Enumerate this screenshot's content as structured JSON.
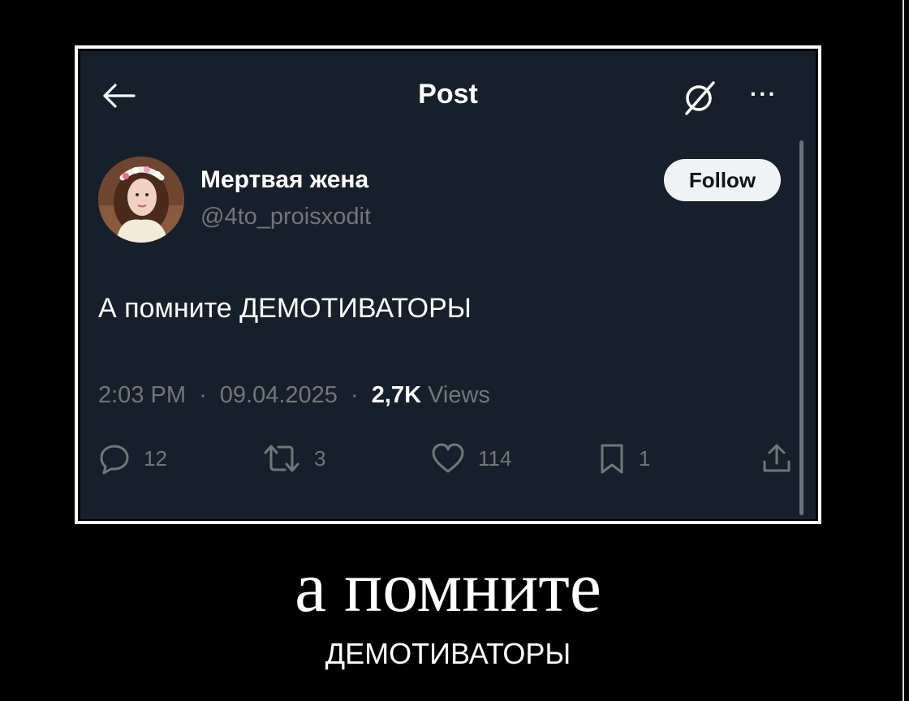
{
  "post": {
    "header": {
      "title": "Post",
      "back_icon": "arrow-left-icon",
      "grok_icon": "grok-icon",
      "more_label": "···"
    },
    "author": {
      "display_name": "Мертвая жена",
      "handle": "@4to_proisxodit",
      "follow_label": "Follow",
      "avatar_icon": "avatar-photo"
    },
    "text": "А помните ДЕМОТИВАТОРЫ",
    "meta": {
      "time": "2:03 PM",
      "date": "09.04.2025",
      "views_count": "2,7K",
      "views_label": "Views",
      "separator": "·"
    },
    "actions": {
      "replies": "12",
      "reposts": "3",
      "likes": "114",
      "bookmarks": "1"
    }
  },
  "caption": {
    "title": "а помните",
    "subtitle": "ДЕМОТИВАТОРЫ"
  },
  "colors": {
    "background": "#000000",
    "screen": "#17202a",
    "muted_text": "#71767b",
    "follow_button": "#eff3f4"
  }
}
